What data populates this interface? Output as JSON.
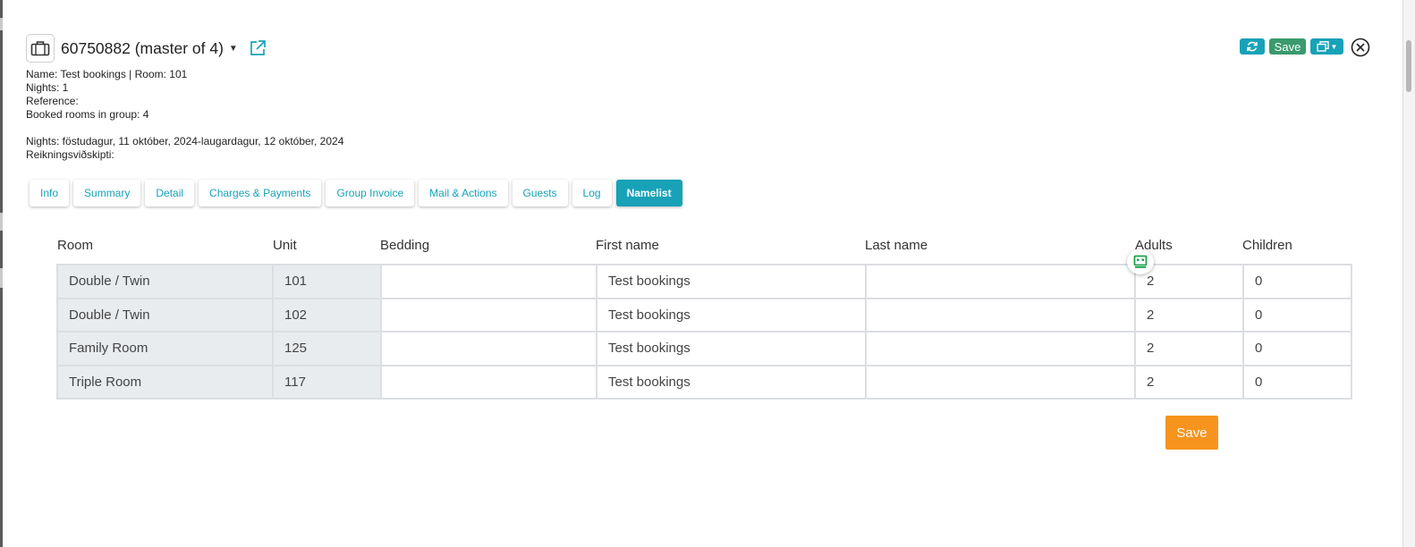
{
  "header": {
    "title": "60750882 (master of 4)",
    "icons": {
      "case": "briefcase-icon",
      "dropdown": "caret-down-icon",
      "external": "external-link-icon"
    }
  },
  "toolbar": {
    "refresh_icon": "refresh-icon",
    "save_label": "Save",
    "copy_icon": "copy-dropdown-icon",
    "close_icon": "close-circle-icon",
    "colors": {
      "teal": "#17a2b8",
      "green": "#3a9a6e"
    }
  },
  "info": {
    "line1": "Name: Test bookings | Room: 101",
    "line2": "Nights: 1",
    "line3": "Reference:",
    "line4": "Booked rooms in group: 4",
    "line5": "Nights: föstudagur, 11 október, 2024-laugardagur, 12 október, 2024",
    "line6": "Reikningsviðskipti:"
  },
  "tabs": [
    {
      "label": "Info"
    },
    {
      "label": "Summary"
    },
    {
      "label": "Detail"
    },
    {
      "label": "Charges & Payments"
    },
    {
      "label": "Group Invoice"
    },
    {
      "label": "Mail & Actions"
    },
    {
      "label": "Guests"
    },
    {
      "label": "Log"
    },
    {
      "label": "Namelist",
      "active": true
    }
  ],
  "grid": {
    "headers": [
      "Room",
      "Unit",
      "Bedding",
      "First name",
      "Last name",
      "Adults",
      "Children"
    ],
    "rows": [
      {
        "room": "Double / Twin",
        "unit": "101",
        "bedding": "",
        "first_name": "Test bookings",
        "last_name": "",
        "adults": "2",
        "children": "0"
      },
      {
        "room": "Double / Twin",
        "unit": "102",
        "bedding": "",
        "first_name": "Test bookings",
        "last_name": "",
        "adults": "2",
        "children": "0"
      },
      {
        "room": "Family Room",
        "unit": "125",
        "bedding": "",
        "first_name": "Test bookings",
        "last_name": "",
        "adults": "2",
        "children": "0"
      },
      {
        "room": "Triple Room",
        "unit": "117",
        "bedding": "",
        "first_name": "Test bookings",
        "last_name": "",
        "adults": "2",
        "children": "0"
      }
    ]
  },
  "floating_icon": "robot-icon",
  "footer": {
    "save_label": "Save",
    "save_color": "#f7941d"
  }
}
